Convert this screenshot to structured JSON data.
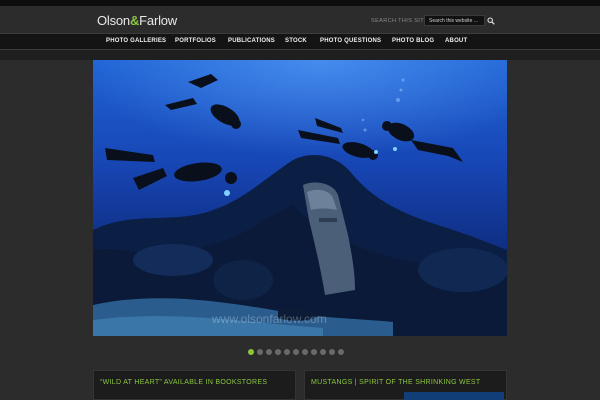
{
  "site": {
    "logo_left": "Olson",
    "logo_amp": "&",
    "logo_right": "Farlow"
  },
  "search": {
    "label": "SEARCH THIS SITE",
    "placeholder": "Search this website ...",
    "button_icon": "search-icon"
  },
  "nav": {
    "items": [
      {
        "label": "PHOTO GALLERIES"
      },
      {
        "label": "PORTFOLIOS"
      },
      {
        "label": "PUBLICATIONS"
      },
      {
        "label": "STOCK"
      },
      {
        "label": "PHOTO QUESTIONS"
      },
      {
        "label": "PHOTO BLOG"
      },
      {
        "label": "ABOUT"
      }
    ]
  },
  "slideshow": {
    "watermark": "www.olsonfarlow.com",
    "slide_count": 11,
    "active_slide": 1
  },
  "panels": [
    {
      "title": "“WILD AT HEART” AVAILABLE IN BOOKSTORES"
    },
    {
      "title": "MUSTANGS | SPIRIT OF THE SHRINKING WEST"
    }
  ],
  "colors": {
    "accent": "#8cc63f",
    "background": "#2c2c2c",
    "nav_background": "#141414"
  }
}
